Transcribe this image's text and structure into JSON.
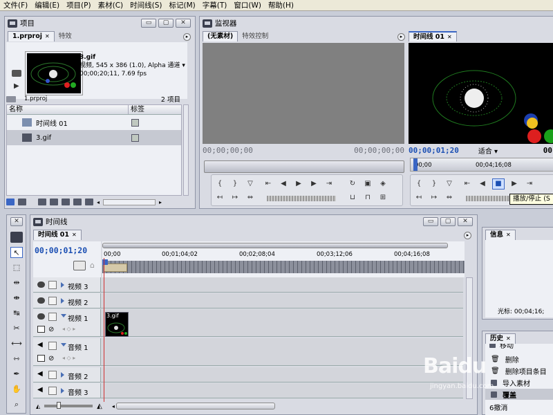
{
  "menu": [
    "文件(F)",
    "编辑(E)",
    "项目(P)",
    "素材(C)",
    "时间线(S)",
    "标记(M)",
    "字幕(T)",
    "窗口(W)",
    "帮助(H)"
  ],
  "project": {
    "title": "项目",
    "tabs": [
      "1.prproj",
      "特效"
    ],
    "clip_name": "3.gif",
    "clip_line1": "视频, 545 x 386 (1.0), Alpha 通道",
    "clip_line2": "00;00;20;11, 7.69 fps",
    "path": "1.prproj",
    "count": "2 项目",
    "col_name": "名称",
    "col_label": "标签",
    "items": [
      {
        "name": "时间线 01",
        "selected": false
      },
      {
        "name": "3.gif",
        "selected": true
      }
    ]
  },
  "monitor": {
    "title": "监视器",
    "source_tabs": [
      "(无素材)",
      "特效控制"
    ],
    "source_tc_left": "00;00;00;00",
    "source_tc_right": "00;00;00;00",
    "program_tab": "时间线 01",
    "program_tc": "00;00;01;20",
    "fit": "适合",
    "program_tc_right": "00",
    "ruler_start": "00;00",
    "ruler_end": "00;04;16;08",
    "tooltip": "播放/停止 (S"
  },
  "timeline": {
    "title": "时间线",
    "tab": "时间线 01",
    "timecode": "00;00;01;20",
    "ruler_labels": [
      "00;00",
      "00;01;04;02",
      "00;02;08;04",
      "00;03;12;06",
      "00;04;16;08"
    ],
    "tracks": [
      {
        "name": "视频 3",
        "type": "video"
      },
      {
        "name": "视频 2",
        "type": "video"
      },
      {
        "name": "视频 1",
        "type": "video",
        "expanded": true
      },
      {
        "name": "音频 1",
        "type": "audio",
        "expanded": true
      },
      {
        "name": "音频 2",
        "type": "audio"
      },
      {
        "name": "音频 3",
        "type": "audio"
      }
    ],
    "clip_label": "3.gif"
  },
  "info": {
    "tab": "信息",
    "partial_text": "光标: 00;04;16;"
  },
  "history": {
    "tab": "历史",
    "items": [
      "移动",
      "删除",
      "删除项目条目",
      "导入素材",
      "覆盖",
      "6撤消"
    ]
  },
  "watermark": {
    "brand": "Baidu",
    "site": "jingyan.baidu.com"
  },
  "colors": {
    "panel": "#d9dbe3",
    "accent": "#3a66c4",
    "playhead": "#d03030"
  }
}
